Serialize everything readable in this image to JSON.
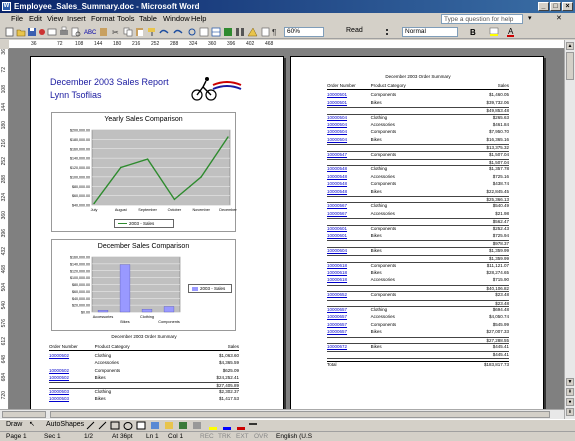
{
  "window": {
    "title": "Employee_Sales_Summary.doc - Microsoft Word",
    "app_icon": "W",
    "minimize": "_",
    "maximize": "□",
    "close": "×"
  },
  "menu": [
    "File",
    "Edit",
    "View",
    "Insert",
    "Format",
    "Tools",
    "Table",
    "Window",
    "Help"
  ],
  "help_placeholder": "Type a question for help",
  "toolbar": {
    "zoom": "60%",
    "read_label": "Read",
    "style": "Normal"
  },
  "ruler": {
    "h": [
      "36",
      "72",
      "108",
      "144",
      "180",
      "216",
      "252",
      "288",
      "324",
      "360",
      "396",
      "402",
      "468"
    ],
    "v": [
      "36",
      "72",
      "108",
      "144",
      "180",
      "216",
      "252",
      "288",
      "324",
      "360",
      "396",
      "432",
      "468",
      "504",
      "540",
      "576",
      "612",
      "648",
      "684",
      "720"
    ]
  },
  "page1": {
    "title": "December 2003 Sales Report",
    "author": "Lynn Tsoflias",
    "yearly": {
      "title": "Yearly Sales Comparison",
      "legend": "2003 - Sales"
    },
    "dec": {
      "title": "December Sales Comparison",
      "legend": "2003 - Sales"
    },
    "summary_title": "December 2003 Order Summary",
    "col_order": "Order Number",
    "col_cat": "Product Category",
    "col_sales": "Sales",
    "rows": [
      {
        "o": "10000502",
        "c": "Clothing",
        "s": "$1,063.60"
      },
      {
        "o": "",
        "c": "Accessories",
        "s": "$4,365.59"
      },
      {
        "o": "10000502",
        "c": "Components",
        "s": "$625.09"
      },
      {
        "o": "10000502",
        "c": "Bikes",
        "s": "$24,252.41"
      },
      {
        "o": "",
        "c": "",
        "s": "$27,405.89"
      },
      {
        "o": "10000503",
        "c": "Clothing",
        "s": "$2,302.37"
      },
      {
        "o": "10000503",
        "c": "Bikes",
        "s": "$1,417.53"
      }
    ]
  },
  "page2": {
    "summary_title": "December 2003 Order Summary",
    "col_order": "Order Number",
    "col_cat": "Product Category",
    "col_sales": "Sales",
    "rows": [
      {
        "o": "10000501",
        "c": "Components",
        "s": "$1,460.05"
      },
      {
        "o": "10000501",
        "c": "Bikes",
        "s": "$39,732.06"
      },
      {
        "o": "",
        "c": "",
        "s": "$49,853.48"
      },
      {
        "o": "10000504",
        "c": "Clothing",
        "s": "$265.63"
      },
      {
        "o": "10000504",
        "c": "Accessories",
        "s": "$461.84"
      },
      {
        "o": "10000504",
        "c": "Components",
        "s": "$7,950.70"
      },
      {
        "o": "10000504",
        "c": "Bikes",
        "s": "$16,365.16"
      },
      {
        "o": "",
        "c": "",
        "s": "$13,375.32"
      },
      {
        "o": "10000547",
        "c": "Components",
        "s": "$1,507.04"
      },
      {
        "o": "",
        "c": "",
        "s": "$1,507.04"
      },
      {
        "o": "10000548",
        "c": "Clothing",
        "s": "$1,357.78"
      },
      {
        "o": "10000548",
        "c": "Accessories",
        "s": "$725.16"
      },
      {
        "o": "10000548",
        "c": "Components",
        "s": "$438.74"
      },
      {
        "o": "10000548",
        "c": "Bikes",
        "s": "$22,845.45"
      },
      {
        "o": "",
        "c": "",
        "s": "$25,366.13"
      },
      {
        "o": "10000567",
        "c": "Clothing",
        "s": "$540.49"
      },
      {
        "o": "10000567",
        "c": "Accessories",
        "s": "$21.98"
      },
      {
        "o": "",
        "c": "",
        "s": "$562.47"
      },
      {
        "o": "10000601",
        "c": "Components",
        "s": "$252.43"
      },
      {
        "o": "10000601",
        "c": "Bikes",
        "s": "$725.94"
      },
      {
        "o": "",
        "c": "",
        "s": "$978.37"
      },
      {
        "o": "10000604",
        "c": "Bikes",
        "s": "$1,359.99"
      },
      {
        "o": "",
        "c": "",
        "s": "$1,359.99"
      },
      {
        "o": "10000618",
        "c": "Components",
        "s": "$11,121.07"
      },
      {
        "o": "10000618",
        "c": "Bikes",
        "s": "$28,274.65"
      },
      {
        "o": "10000618",
        "c": "Accessories",
        "s": "$715.90"
      },
      {
        "o": "",
        "c": "",
        "s": "$40,106.82"
      },
      {
        "o": "10000652",
        "c": "Components",
        "s": "$23.48"
      },
      {
        "o": "",
        "c": "",
        "s": "$23.48"
      },
      {
        "o": "10000657",
        "c": "Clothing",
        "s": "$694.48"
      },
      {
        "o": "10000657",
        "c": "Accessories",
        "s": "$4,050.74"
      },
      {
        "o": "10000657",
        "c": "Components",
        "s": "$545.99"
      },
      {
        "o": "10000657",
        "c": "Bikes",
        "s": "$27,007.33"
      },
      {
        "o": "",
        "c": "",
        "s": "$27,288.55"
      },
      {
        "o": "10000672",
        "c": "Bikes",
        "s": "$445.41"
      },
      {
        "o": "",
        "c": "",
        "s": "$445.41"
      }
    ],
    "total_label": "Total",
    "total_value": "$183,817.73"
  },
  "drawbar": {
    "draw": "Draw",
    "autoshapes": "AutoShapes"
  },
  "status": {
    "page": "Page 1",
    "sec": "Sec 1",
    "pages": "1/2",
    "at": "At 36pt",
    "ln": "Ln 1",
    "col": "Col 1",
    "rec": "REC",
    "trk": "TRK",
    "ext": "EXT",
    "ovr": "OVR",
    "lang": "English (U.S"
  },
  "chart_data": [
    {
      "type": "line",
      "title": "Yearly Sales Comparison",
      "categories": [
        "July",
        "August",
        "September",
        "October",
        "November",
        "December"
      ],
      "series": [
        {
          "name": "2003 - Sales",
          "values": [
            43000,
            120000,
            138000,
            52000,
            100000,
            185000
          ]
        }
      ],
      "yticks": [
        "$200,000.00",
        "$180,000.00",
        "$160,000.00",
        "$140,000.00",
        "$120,000.00",
        "$100,000.00",
        "$80,000.00",
        "$60,000.00",
        "$40,000.00"
      ],
      "ylim": [
        40000,
        200000
      ],
      "color": "#2e8b2e"
    },
    {
      "type": "bar",
      "title": "December Sales Comparison",
      "categories": [
        "Accessories",
        "Bikes",
        "Clothing",
        "Components"
      ],
      "series": [
        {
          "name": "2003 - Sales",
          "values": [
            5000,
            138000,
            8000,
            16000
          ]
        }
      ],
      "yticks": [
        "$160,000.00",
        "$140,000.00",
        "$120,000.00",
        "$100,000.00",
        "$80,000.00",
        "$60,000.00",
        "$40,000.00",
        "$20,000.00",
        "$0.00"
      ],
      "ylim": [
        0,
        160000
      ],
      "color": "#9999ff"
    }
  ]
}
